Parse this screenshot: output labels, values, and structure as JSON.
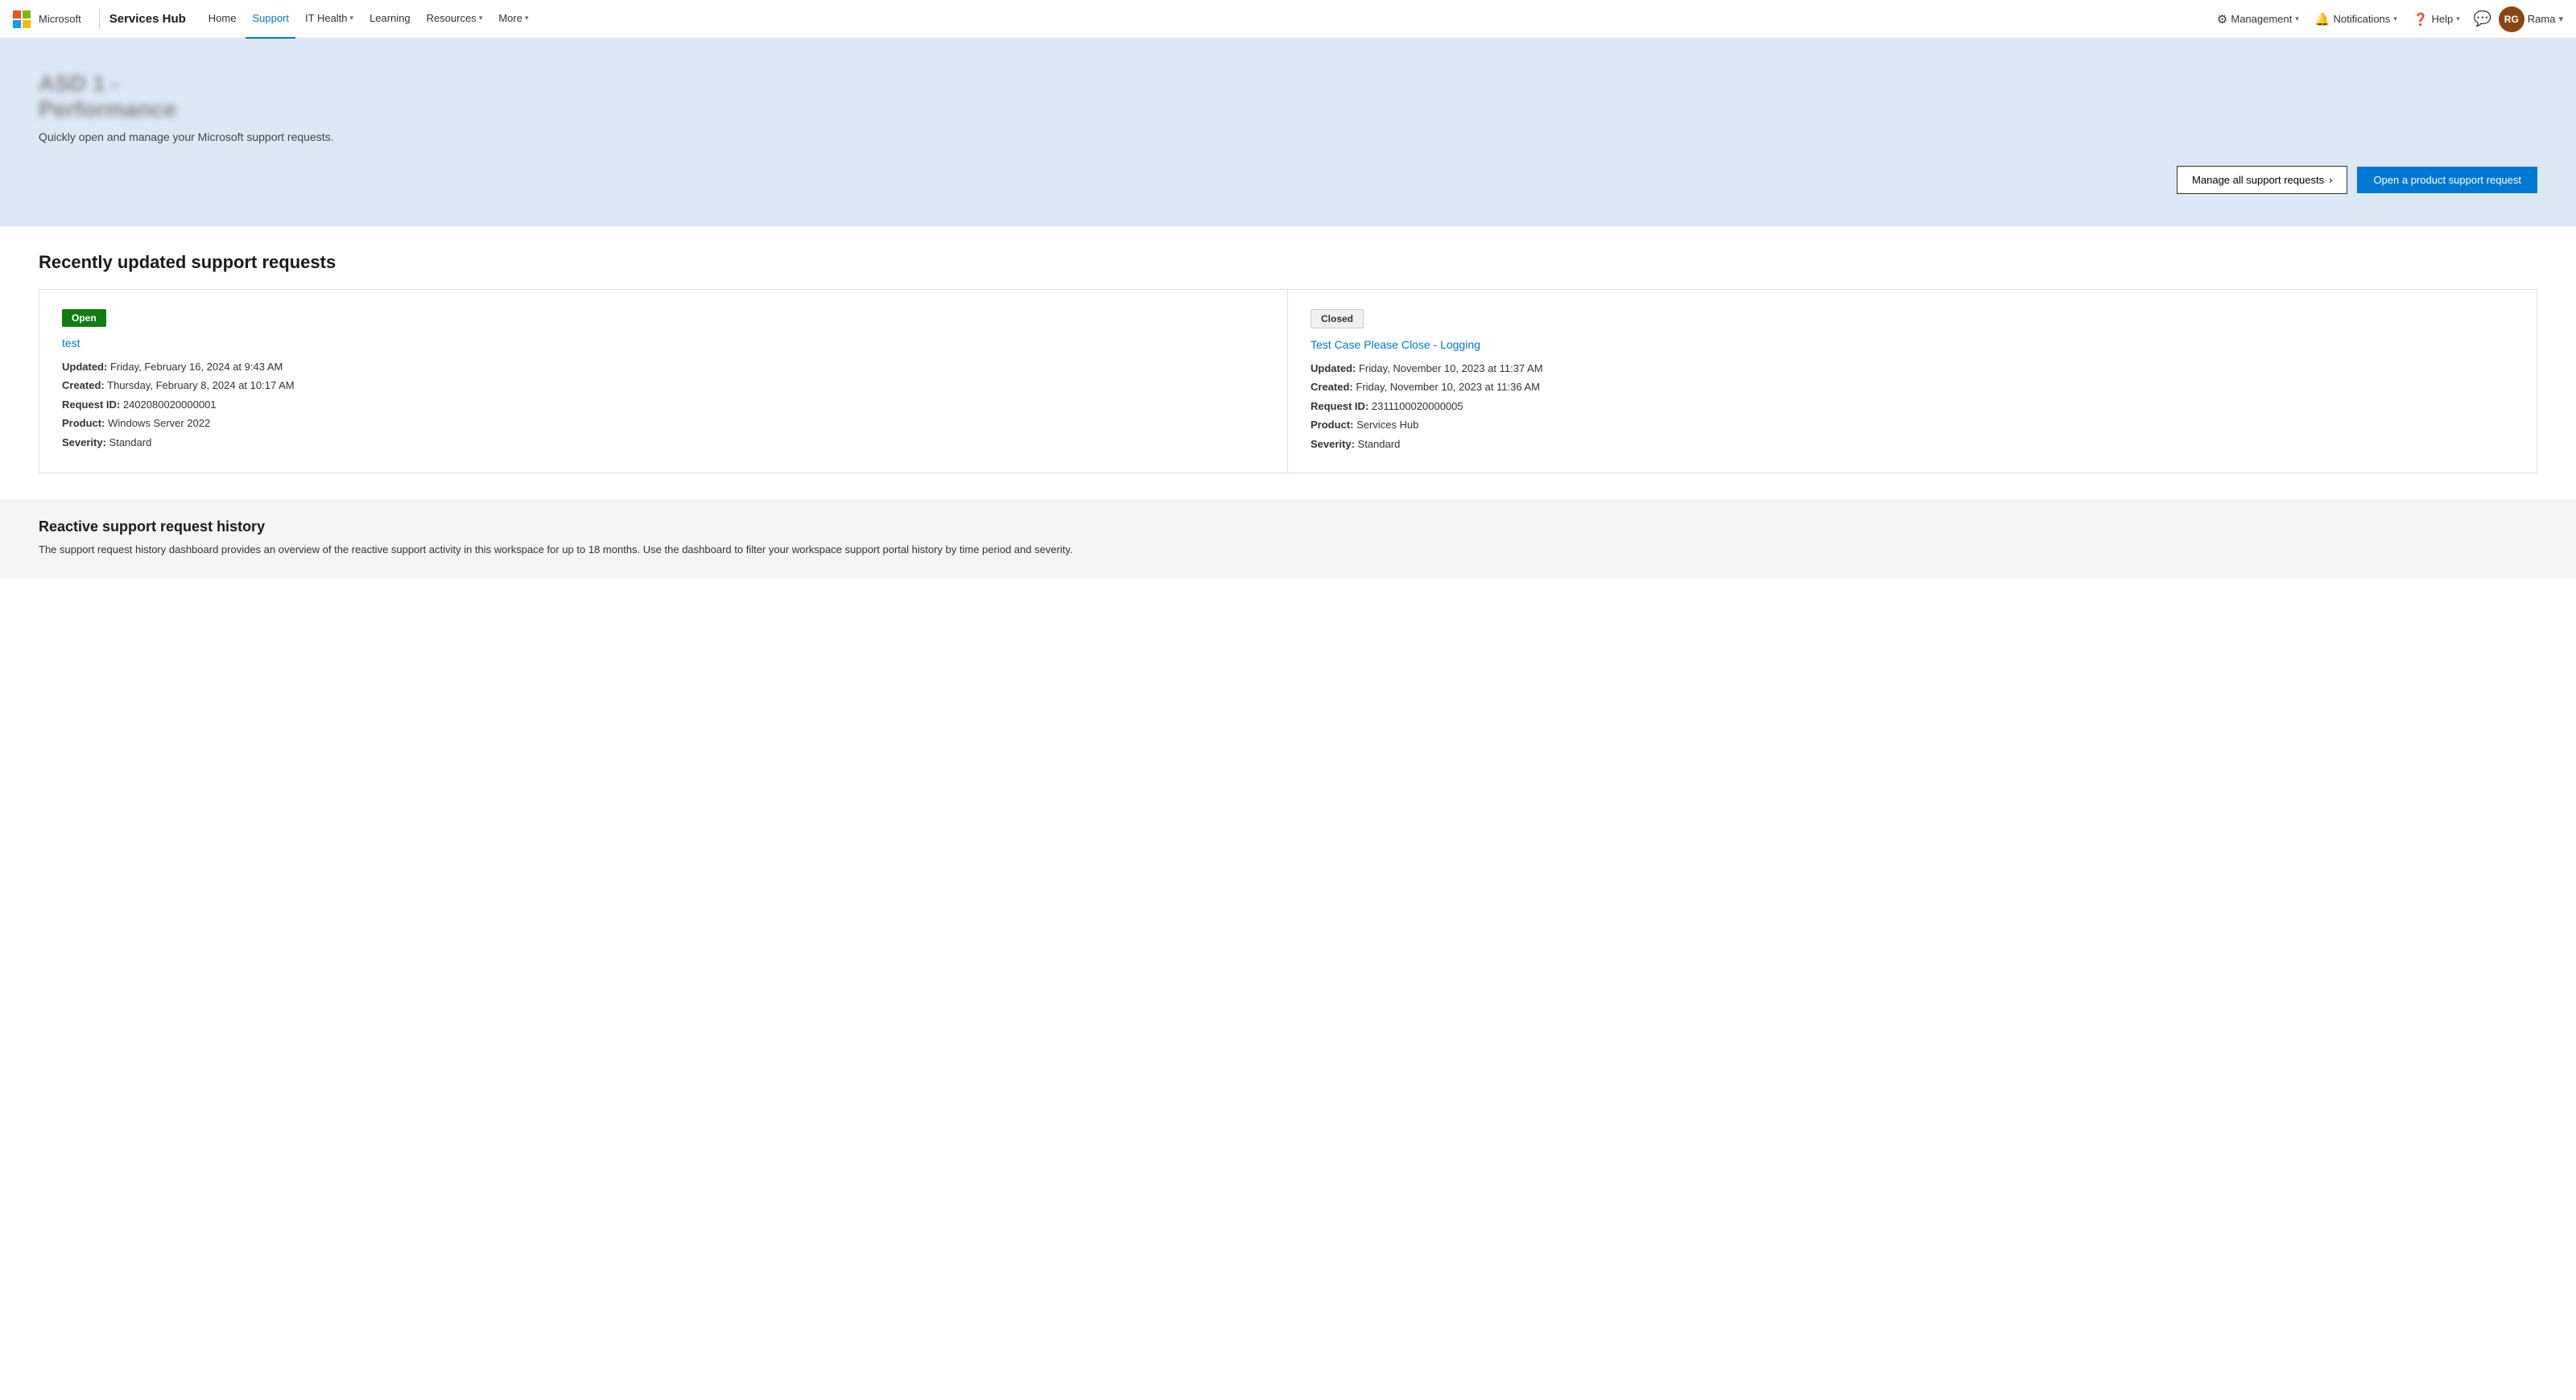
{
  "nav": {
    "logo_text": "Microsoft",
    "brand": "Services Hub",
    "items": [
      {
        "label": "Home",
        "active": false
      },
      {
        "label": "Support",
        "active": true
      },
      {
        "label": "IT Health",
        "active": false,
        "has_chevron": true
      },
      {
        "label": "Learning",
        "active": false
      },
      {
        "label": "Resources",
        "active": false,
        "has_chevron": true
      },
      {
        "label": "More",
        "active": false,
        "has_chevron": true
      }
    ],
    "right_items": [
      {
        "label": "Management",
        "has_chevron": true,
        "has_icon": true
      },
      {
        "label": "Notifications",
        "has_chevron": true,
        "has_icon": true
      },
      {
        "label": "Help",
        "has_chevron": true,
        "has_icon": true
      }
    ],
    "avatar_initials": "RG",
    "user_name": "Rama"
  },
  "hero": {
    "title": "ASD 1 - Performance",
    "subtitle": "Quickly open and manage your Microsoft support requests.",
    "btn_manage_label": "Manage all support requests",
    "btn_open_label": "Open a product support request"
  },
  "recently_updated": {
    "section_title": "Recently updated support requests",
    "cards": [
      {
        "status": "Open",
        "status_type": "open",
        "title": "test",
        "updated": "Friday, February 16, 2024 at 9:43 AM",
        "created": "Thursday, February 8, 2024 at 10:17 AM",
        "request_id": "2402080020000001",
        "product": "Windows Server 2022",
        "severity": "Standard"
      },
      {
        "status": "Closed",
        "status_type": "closed",
        "title": "Test Case Please Close - Logging",
        "updated": "Friday, November 10, 2023 at 11:37 AM",
        "created": "Friday, November 10, 2023 at 11:36 AM",
        "request_id": "2311100020000005",
        "product": "Services Hub",
        "severity": "Standard"
      }
    ]
  },
  "history": {
    "title": "Reactive support request history",
    "description": "The support request history dashboard provides an overview of the reactive support activity in this workspace for up to 18 months. Use the dashboard to filter your workspace support portal history by time period and severity."
  },
  "labels": {
    "updated": "Updated:",
    "created": "Created:",
    "request_id": "Request ID:",
    "product": "Product:",
    "severity": "Severity:"
  }
}
